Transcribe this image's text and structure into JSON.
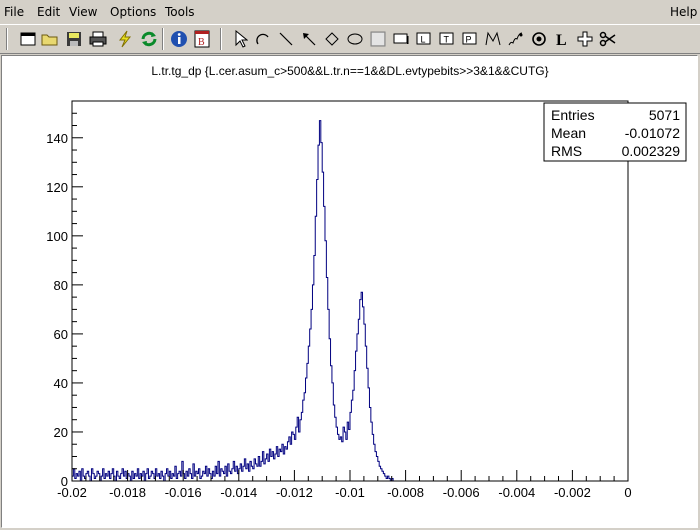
{
  "menubar": {
    "file": "File",
    "edit": "Edit",
    "view": "View",
    "options": "Options",
    "tools": "Tools",
    "help": "Help"
  },
  "toolbar": {
    "icons": [
      "new-canvas-icon",
      "open-icon",
      "save-icon",
      "print-icon",
      "interrupt-icon",
      "refresh-icon",
      "info-icon",
      "browser-icon",
      "pointer-icon",
      "arc-icon",
      "line-icon",
      "arrow-icon",
      "diamond-icon",
      "ellipse-icon",
      "pad-icon",
      "pave-icon",
      "pave-label-icon",
      "pave-text-icon",
      "paves-text-icon",
      "polyline-icon",
      "curly-line-icon",
      "marker-icon",
      "latex-icon",
      "graph-cross-icon",
      "cut-icon"
    ]
  },
  "colors": {
    "window_bg": "#d4d0c8",
    "histogram_line": "#000080",
    "canvas_bg": "#ffffff"
  },
  "chart_data": {
    "type": "histogram",
    "title": "L.tr.tg_dp {L.cer.asum_c>500&&L.tr.n==1&&DL.evtypebits>>3&1&&CUTG}",
    "xlim": [
      -0.02,
      0
    ],
    "ylim": [
      0,
      155
    ],
    "xticks": [
      -0.02,
      -0.018,
      -0.016,
      -0.014,
      -0.012,
      -0.01,
      -0.008,
      -0.006,
      -0.004,
      -0.002,
      0
    ],
    "xtick_labels": [
      "-0.02",
      "-0.018",
      "-0.016",
      "-0.014",
      "-0.012",
      "-0.01",
      "-0.008",
      "-0.006",
      "-0.004",
      "-0.002",
      "0"
    ],
    "yticks": [
      0,
      20,
      40,
      60,
      80,
      100,
      120,
      140
    ],
    "ytick_labels": [
      "0",
      "20",
      "40",
      "60",
      "80",
      "100",
      "120",
      "140"
    ],
    "grid": false,
    "stats": {
      "entries_label": "Entries",
      "entries_value": "5071",
      "mean_label": "Mean",
      "mean_value": "-0.01072",
      "rms_label": "RMS",
      "rms_value": "0.002329"
    },
    "bins": {
      "x_start": -0.02,
      "bin_width": 5e-05,
      "values": [
        2,
        5,
        1,
        3,
        2,
        4,
        0,
        5,
        2,
        1,
        3,
        4,
        2,
        0,
        5,
        3,
        1,
        2,
        4,
        3,
        0,
        2,
        5,
        1,
        3,
        2,
        4,
        1,
        3,
        5,
        2,
        0,
        4,
        2,
        1,
        3,
        5,
        2,
        4,
        1,
        3,
        2,
        0,
        4,
        1,
        3,
        2,
        5,
        1,
        3,
        2,
        4,
        0,
        3,
        5,
        1,
        2,
        4,
        3,
        1,
        5,
        2,
        3,
        1,
        4,
        2,
        0,
        3,
        5,
        2,
        4,
        1,
        3,
        2,
        6,
        1,
        3,
        4,
        2,
        8,
        3,
        1,
        4,
        2,
        5,
        3,
        1,
        7,
        2,
        4,
        3,
        5,
        1,
        2,
        4,
        3,
        6,
        2,
        5,
        3,
        1,
        4,
        2,
        6,
        3,
        8,
        2,
        5,
        4,
        3,
        6,
        2,
        7,
        4,
        3,
        5,
        8,
        4,
        6,
        3,
        5,
        7,
        4,
        6,
        9,
        5,
        7,
        4,
        8,
        6,
        5,
        9,
        7,
        6,
        10,
        6,
        8,
        12,
        7,
        9,
        11,
        8,
        13,
        10,
        12,
        9,
        11,
        14,
        10,
        13,
        12,
        15,
        11,
        14,
        13,
        16,
        18,
        15,
        20,
        19,
        17,
        22,
        26,
        20,
        25,
        28,
        33,
        36,
        42,
        48,
        55,
        62,
        70,
        80,
        92,
        108,
        123,
        137,
        147,
        138,
        126,
        112,
        98,
        83,
        70,
        58,
        47,
        40,
        31,
        26,
        22,
        19,
        17,
        18,
        16,
        22,
        20,
        17,
        24,
        21,
        28,
        33,
        37,
        45,
        53,
        60,
        66,
        74,
        77,
        71,
        64,
        55,
        46,
        38,
        30,
        24,
        19,
        15,
        12,
        10,
        8,
        6,
        5,
        4,
        3,
        2,
        1,
        2,
        1,
        0,
        1,
        0,
        0,
        0
      ]
    }
  }
}
